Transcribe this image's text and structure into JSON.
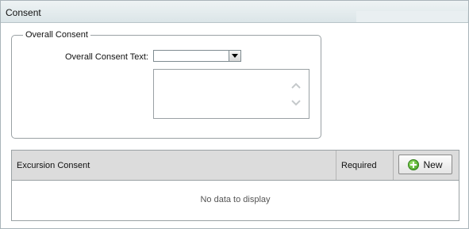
{
  "window": {
    "title": "Consent"
  },
  "overall": {
    "legend": "Overall Consent",
    "text_label": "Overall Consent Text:",
    "combo_value": "",
    "textarea_value": ""
  },
  "grid": {
    "columns": [
      "Excursion Consent",
      "Required"
    ],
    "new_button_label": "New",
    "empty_text": "No data to display"
  }
}
